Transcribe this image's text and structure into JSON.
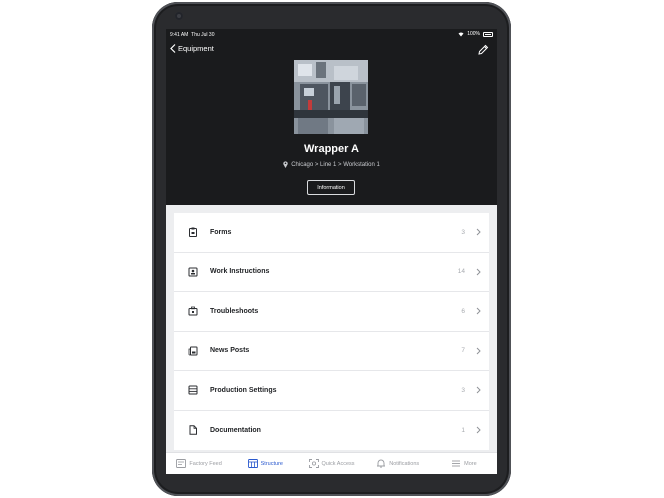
{
  "status": {
    "time": "9:41 AM",
    "date": "Thu Jul 30",
    "battery": "100%"
  },
  "nav": {
    "back_label": "Equipment"
  },
  "equipment": {
    "name": "Wrapper A",
    "location": "Chicago > Line 1 > Workstation 1",
    "info_button": "Information"
  },
  "list": [
    {
      "label": "Forms",
      "count": "3",
      "icon": "clipboard-icon"
    },
    {
      "label": "Work Instructions",
      "count": "14",
      "icon": "person-card-icon"
    },
    {
      "label": "Troubleshoots",
      "count": "6",
      "icon": "toolbox-icon"
    },
    {
      "label": "News Posts",
      "count": "7",
      "icon": "news-icon"
    },
    {
      "label": "Production Settings",
      "count": "3",
      "icon": "server-icon"
    },
    {
      "label": "Documentation",
      "count": "1",
      "icon": "document-icon"
    }
  ],
  "tabs": [
    {
      "label": "Factory Feed",
      "icon": "feed-icon",
      "active": false
    },
    {
      "label": "Structure",
      "icon": "structure-icon",
      "active": true
    },
    {
      "label": "Quick Access",
      "icon": "scan-icon",
      "active": false
    },
    {
      "label": "Notifications",
      "icon": "bell-icon",
      "active": false
    },
    {
      "label": "More",
      "icon": "menu-icon",
      "active": false
    }
  ],
  "colors": {
    "accent": "#2a59ce",
    "header_bg": "#1a1b1d",
    "content_bg": "#edeef0"
  }
}
